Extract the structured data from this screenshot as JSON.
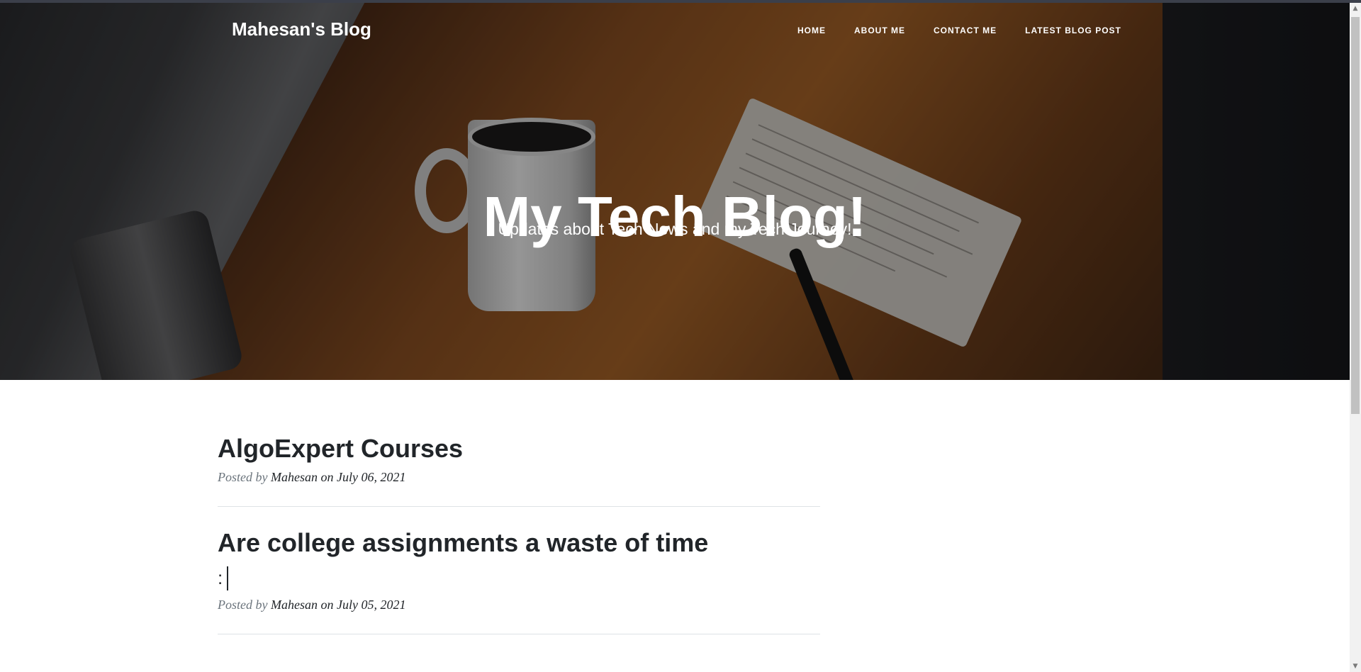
{
  "header": {
    "brand": "Mahesan's Blog",
    "nav": [
      "HOME",
      "ABOUT ME",
      "CONTACT ME",
      "LATEST BLOG POST"
    ]
  },
  "hero": {
    "title": "My Tech Blog!",
    "subtitle": "Updates about Tech News and my Tech Journey!"
  },
  "posts": [
    {
      "title": "AlgoExpert Courses",
      "subtitle": "",
      "posted_by_label": "Posted by",
      "author": "Mahesan",
      "date_text": "on July 06, 2021"
    },
    {
      "title": "Are college assignments a waste of time",
      "subtitle": ":",
      "posted_by_label": "Posted by",
      "author": "Mahesan",
      "date_text": "on July 05, 2021"
    }
  ],
  "scrollbar": {
    "up_icon": "arrow-up-icon",
    "down_icon": "arrow-down-icon"
  }
}
